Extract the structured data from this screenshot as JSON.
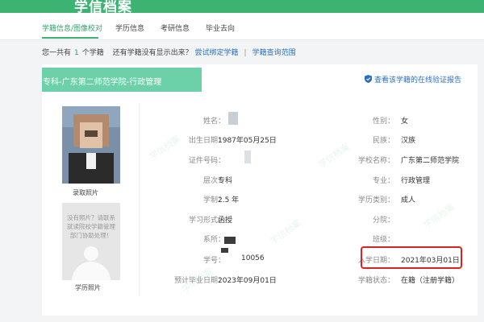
{
  "header": {
    "logo_text": "学信档案"
  },
  "tabs": [
    {
      "label": "学籍信息/图像校对"
    },
    {
      "label": "学历信息"
    },
    {
      "label": "考研信息"
    },
    {
      "label": "毕业去向"
    }
  ],
  "summary": {
    "prefix": "您一共有",
    "count": "1",
    "suffix": "个学籍",
    "question": "还有学籍没有显示出来？",
    "bind_link": "尝试绑定学籍",
    "separator": "|",
    "scope_link": "学籍查询范围"
  },
  "record": {
    "banner": "专科-广东第二师范学院-行政管理",
    "verify_link": "查看该学籍的在线验证报告",
    "admission_photo_label": "录取照片",
    "degree_photo_label": "学历照片",
    "no_photo_notice": "没有照片？请联系就读院校学籍管理部门协助处理！",
    "fields": {
      "name_label": "姓名：",
      "gender_label": "性别：",
      "gender": "女",
      "birth_label": "出生日期：",
      "birth": "1987年05月25日",
      "ethnicity_label": "民族：",
      "ethnicity": "汉族",
      "id_label": "证件号码：",
      "school_label": "学校名称：",
      "school": "广东第二师范学院",
      "level_label": "层次：",
      "level": "专科",
      "major_label": "专业：",
      "major": "行政管理",
      "duration_label": "学制：",
      "duration": "2.5 年",
      "category_label": "学历类别：",
      "category": "成人",
      "form_label": "学习形式：",
      "form": "函授",
      "branch_label": "分院：",
      "dept_label": "系所：",
      "class_label": "班级：",
      "student_no_label": "学号：",
      "student_no": "10056",
      "admission_label": "入学日期：",
      "admission": "2021年03月01日",
      "grad_label": "预计毕业日期：",
      "grad": "2023年09月01日",
      "status_label": "学籍状态：",
      "status": "在籍（注册学籍）"
    }
  },
  "watermark_text": "学信档案",
  "colors": {
    "brand": "#3cb371",
    "banner": "#6cd1a9",
    "link": "#2a6fbe",
    "highlight": "#e02020"
  }
}
